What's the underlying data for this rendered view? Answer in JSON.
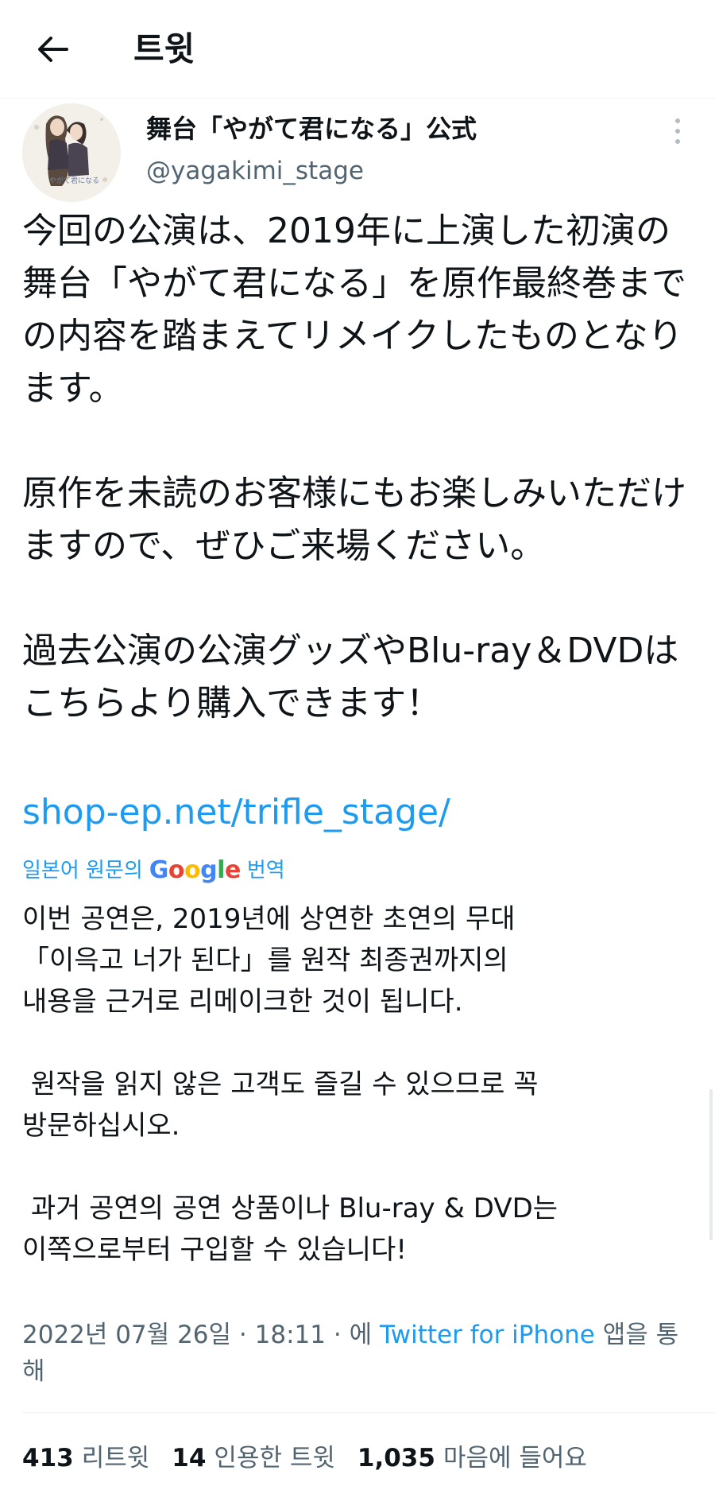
{
  "header": {
    "title": "트윗"
  },
  "author": {
    "display_name": "舞台「やがて君になる」公式",
    "handle": "@yagakimi_stage"
  },
  "tweet": {
    "paragraphs": [
      "今回の公演は、2019年に上演した初演の舞台「やがて君になる」を原作最終巻までの内容を踏まえてリメイクしたものとなります。",
      "原作を未読のお客様にもお楽しみいただけますので、ぜひご来場ください。",
      "過去公演の公演グッズやBlu-ray＆DVDはこちらより購入できます！"
    ],
    "link": "shop-ep.net/trifle_stage/"
  },
  "translate": {
    "prefix": "일본어 원문의",
    "google": [
      "G",
      "o",
      "o",
      "g",
      "l",
      "e"
    ],
    "suffix": "번역"
  },
  "translation": {
    "paragraphs": [
      "이번 공연은, 2019년에 상연한 초연의 무대\n「이윽고 너가 된다」를 원작 최종권까지의\n내용을 근거로 리메이크한 것이 됩니다.",
      " 원작을 읽지 않은 고객도 즐길 수 있으므로 꼭\n방문하십시오.",
      " 과거 공연의 공연 상품이나 Blu-ray & DVD는\n이쪽으로부터 구입할 수 있습니다!"
    ]
  },
  "meta": {
    "date": "2022년 07월 26일",
    "time": "18:11",
    "via_prefix": "에",
    "source": "Twitter for iPhone",
    "via_suffix": "앱을 통해"
  },
  "stats": {
    "retweets": {
      "num": "413",
      "label": "리트윗"
    },
    "quotes": {
      "num": "14",
      "label": "인용한 트윗"
    },
    "likes": {
      "num": "1,035",
      "label": "마음에 들어요"
    }
  },
  "colors": {
    "link": "#1d9bf0",
    "secondary_text": "#536471",
    "primary_text": "#0f1419"
  },
  "icons": {
    "back": "back-arrow-icon",
    "more": "more-vertical-icon"
  }
}
